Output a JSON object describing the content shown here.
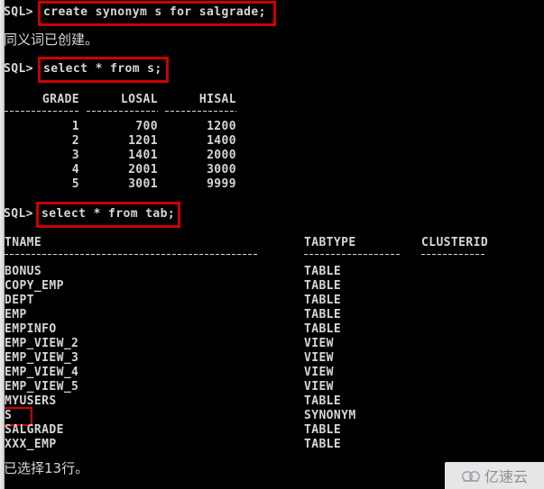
{
  "terminal": {
    "prompt": "SQL>",
    "statements": {
      "create_synonym": "create synonym s for salgrade;",
      "select_from_s": "select * from s;",
      "select_from_tab": "select * from tab;"
    },
    "messages": {
      "synonym_created": "同义词已创建。",
      "rows_selected": "已选择13行。"
    }
  },
  "salgrade_table": {
    "headers": [
      "GRADE",
      "LOSAL",
      "HISAL"
    ],
    "rows": [
      [
        "1",
        "700",
        "1200"
      ],
      [
        "2",
        "1201",
        "1400"
      ],
      [
        "3",
        "1401",
        "2000"
      ],
      [
        "4",
        "2001",
        "3000"
      ],
      [
        "5",
        "3001",
        "9999"
      ]
    ]
  },
  "tab_table": {
    "headers": [
      "TNAME",
      "TABTYPE",
      "CLUSTERID"
    ],
    "rows": [
      [
        "BONUS",
        "TABLE",
        ""
      ],
      [
        "COPY_EMP",
        "TABLE",
        ""
      ],
      [
        "DEPT",
        "TABLE",
        ""
      ],
      [
        "EMP",
        "TABLE",
        ""
      ],
      [
        "EMPINFO",
        "TABLE",
        ""
      ],
      [
        "EMP_VIEW_2",
        "VIEW",
        ""
      ],
      [
        "EMP_VIEW_3",
        "VIEW",
        ""
      ],
      [
        "EMP_VIEW_4",
        "VIEW",
        ""
      ],
      [
        "EMP_VIEW_5",
        "VIEW",
        ""
      ],
      [
        "MYUSERS",
        "TABLE",
        ""
      ],
      [
        "S",
        "SYNONYM",
        ""
      ],
      [
        "SALGRADE",
        "TABLE",
        ""
      ],
      [
        "XXX_EMP",
        "TABLE",
        ""
      ]
    ]
  },
  "annotations": {
    "highlight_color": "#cc0000",
    "boxes": [
      {
        "label": "create-synonym-statement"
      },
      {
        "label": "select-from-s-statement"
      },
      {
        "label": "select-from-tab-statement"
      },
      {
        "label": "synonym-row-s"
      }
    ]
  },
  "watermark": {
    "text": "亿速云",
    "icon": "cloud-icon"
  }
}
